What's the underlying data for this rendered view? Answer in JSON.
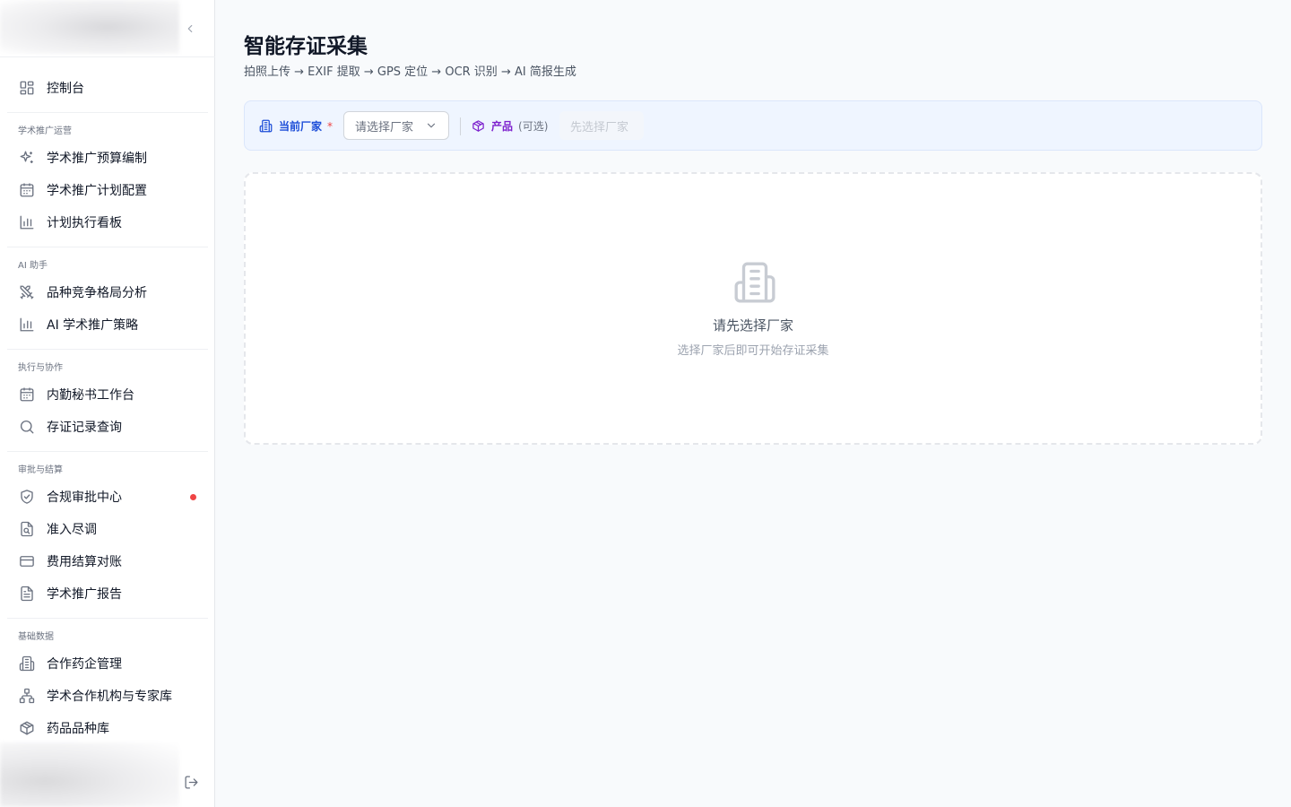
{
  "sidebar": {
    "dashboard": {
      "label": "控制台",
      "icon": "layout-grid-icon"
    },
    "groups": [
      {
        "title": "学术推广运营",
        "items": [
          {
            "label": "学术推广预算编制",
            "icon": "sparkles-icon"
          },
          {
            "label": "学术推广计划配置",
            "icon": "calendar-icon"
          },
          {
            "label": "计划执行看板",
            "icon": "bar-chart-icon"
          }
        ]
      },
      {
        "title": "AI 助手",
        "items": [
          {
            "label": "品种竞争格局分析",
            "icon": "swords-icon"
          },
          {
            "label": "AI 学术推广策略",
            "icon": "bar-chart-icon"
          }
        ]
      },
      {
        "title": "执行与协作",
        "items": [
          {
            "label": "内勤秘书工作台",
            "icon": "calendar-icon"
          },
          {
            "label": "存证记录查询",
            "icon": "search-icon"
          }
        ]
      },
      {
        "title": "审批与结算",
        "items": [
          {
            "label": "合规审批中心",
            "icon": "shield-check-icon",
            "badge_color": "#ef4444"
          },
          {
            "label": "准入尽调",
            "icon": "file-search-icon"
          },
          {
            "label": "费用结算对账",
            "icon": "credit-card-icon"
          },
          {
            "label": "学术推广报告",
            "icon": "file-text-icon"
          }
        ]
      },
      {
        "title": "基础数据",
        "items": [
          {
            "label": "合作药企管理",
            "icon": "building-icon"
          },
          {
            "label": "学术合作机构与专家库",
            "icon": "network-icon"
          },
          {
            "label": "药品品种库",
            "icon": "package-icon"
          }
        ]
      }
    ]
  },
  "header": {
    "title": "智能存证采集",
    "subtitle": "拍照上传 → EXIF 提取 → GPS 定位 → OCR 识别 → AI 简报生成"
  },
  "filter": {
    "vendor_label": "当前厂家",
    "vendor_required": "*",
    "vendor_placeholder": "请选择厂家",
    "product_label": "产品",
    "product_optional": "(可选)",
    "product_placeholder": "先选择厂家"
  },
  "empty_state": {
    "title": "请先选择厂家",
    "description": "选择厂家后即可开始存证采集"
  },
  "colors": {
    "accent_blue": "#1d4ed8",
    "accent_purple": "#7e22ce",
    "alert_red": "#ef4444"
  }
}
